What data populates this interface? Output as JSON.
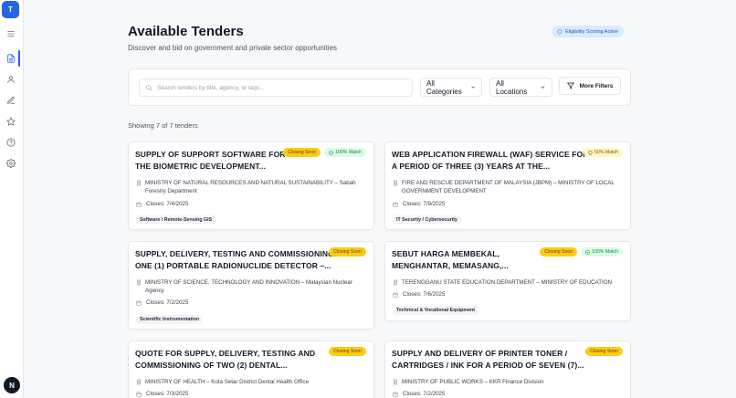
{
  "sidebar": {
    "logo_letter": "T",
    "avatar_letter": "N",
    "items": [
      {
        "icon": "menu-icon"
      },
      {
        "icon": "document-icon",
        "active": true
      },
      {
        "icon": "user-icon"
      },
      {
        "icon": "edit-icon"
      },
      {
        "icon": "star-icon"
      },
      {
        "icon": "help-icon"
      },
      {
        "icon": "settings-icon"
      }
    ]
  },
  "header": {
    "title": "Available Tenders",
    "subtitle": "Discover and bid on government and private sector opportunities",
    "eligibility_badge": "Eligibility Scoring Active"
  },
  "filters": {
    "search_placeholder": "Search tenders by title, agency, or tags...",
    "category": "All Categories",
    "location": "All Locations",
    "more_filters": "More Filters"
  },
  "showing_text": "Showing 7 of 7 tenders",
  "tenders": [
    {
      "title_line1": "SUPPLY OF SUPPORT SOFTWARE FOR",
      "title_line2": "THE BIOMETRIC DEVELOPMENT...",
      "closing": "Closing Soon",
      "match": "100% Match",
      "agency_line1": "MINISTRY OF NATURAL RESOURCES AND NATURAL SUSTAINABILITY – Sabah",
      "agency_line2": "Forestry Department",
      "closes": "Closes: 7/4/2025",
      "tag": "Software / Remote-Sensing GIS"
    },
    {
      "title_line1": "WEB APPLICATION FIREWALL (WAF) SERVICE FOR",
      "title_line2": "A PERIOD OF THREE (3) YEARS AT THE...",
      "match": "50% Match",
      "agency_line1": "FIRE AND RESCUE DEPARTMENT OF MALAYSIA (JBPM) – MINISTRY OF LOCAL",
      "agency_line2": "GOVERNMENT DEVELOPMENT",
      "closes": "Closes: 7/9/2025",
      "tag": "IT Security / Cybersecurity"
    },
    {
      "title_line1": "SUPPLY, DELIVERY, TESTING AND COMMISSIONING",
      "title_line2": "ONE (1) PORTABLE RADIONUCLIDE DETECTOR –...",
      "closing": "Closing Soon",
      "agency_line1": "MINISTRY OF SCIENCE, TECHNOLOGY AND INNOVATION – Malaysian Nuclear",
      "agency_line2": "Agency",
      "closes": "Closes: 7/2/2025",
      "tag": "Scientific Instrumentation"
    },
    {
      "title_line1": "SEBUT HARGA MEMBEKAL,",
      "title_line2": "MENGHANTAR, MEMASANG,...",
      "closing": "Closing Soon",
      "match": "100% Match",
      "agency_line1": "TERENGGANU STATE EDUCATION DEPARTMENT – MINISTRY OF EDUCATION",
      "closes": "Closes: 7/6/2025",
      "tag": "Technical & Vocational Equipment"
    },
    {
      "title_line1": "QUOTE FOR SUPPLY, DELIVERY, TESTING AND",
      "title_line2": "COMMISSIONING OF TWO (2) DENTAL...",
      "closing": "Closing Soon",
      "agency_line1": "MINISTRY OF HEALTH – Kota Setar District Dental Health Office",
      "closes": "Closes: 7/3/2025"
    },
    {
      "title_line1": "SUPPLY AND DELIVERY OF PRINTER TONER /",
      "title_line2": "CARTRIDGES / INK FOR A PERIOD OF SEVEN (7)...",
      "closing": "Closing Soon",
      "agency_line1": "MINISTRY OF PUBLIC WORKS – KKR Finance Division",
      "closes": "Closes: 7/2/2025"
    }
  ]
}
